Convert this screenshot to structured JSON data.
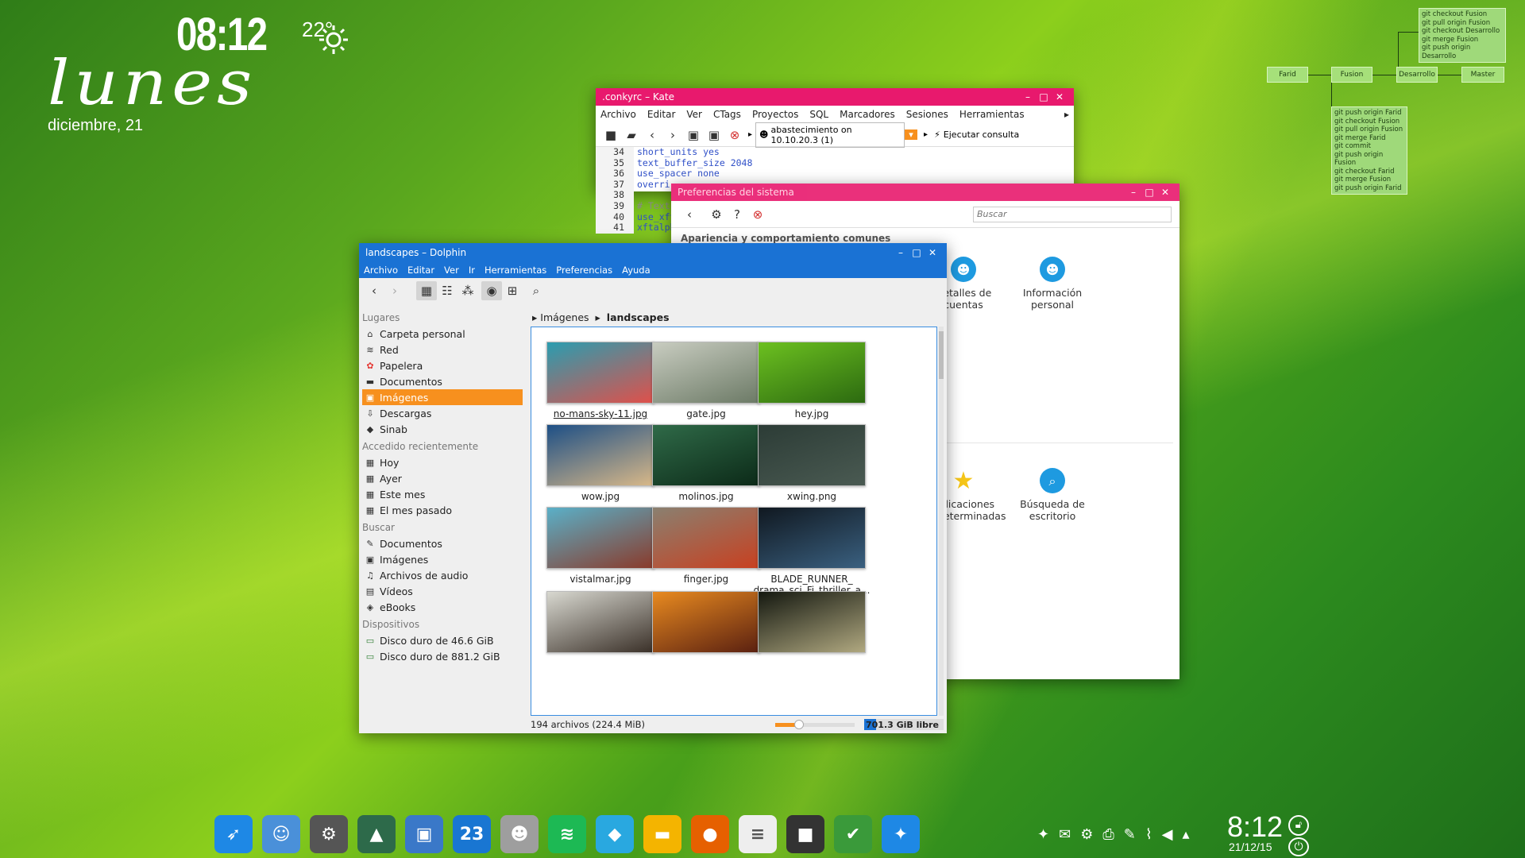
{
  "conky": {
    "time": "08:12",
    "temperature": "22°",
    "weather_icon": "sun-icon",
    "day": "lunes",
    "date": "diciembre, 21"
  },
  "git_graph": {
    "top_box": [
      "git checkout Fusion",
      "git pull origin Fusion",
      "git checkout Desarrollo",
      "git merge Fusion",
      "git push origin Desarrollo"
    ],
    "nodes": [
      "Farid",
      "Fusion",
      "Desarrollo",
      "Master"
    ],
    "bottom_box": [
      "git push origin Farid",
      "git checkout Fusion",
      "git pull origin Fusion",
      "git merge Farid",
      "git commit",
      "git push origin Fusion",
      "git checkout Farid",
      "git merge Fusion",
      "git push origin Farid"
    ]
  },
  "kate": {
    "title": ".conkyrc – Kate",
    "menu": [
      "Archivo",
      "Editar",
      "Ver",
      "CTags",
      "Proyectos",
      "SQL",
      "Marcadores",
      "Sesiones",
      "Herramientas"
    ],
    "connection": "abastecimiento on 10.10.20.3 (1)",
    "run_query": "Ejecutar consulta",
    "line_numbers": [
      "34",
      "35",
      "36",
      "37",
      "38",
      "39",
      "40",
      "41"
    ],
    "lines": [
      "short_units yes",
      "text_buffer_size 2048",
      "use_spacer none",
      "overri",
      "",
      "# Text",
      "use_xft",
      "xftalph"
    ]
  },
  "prefs": {
    "title": "Preferencias del sistema",
    "search_placeholder": "Buscar",
    "section": "Apariencia y comportamiento comunes",
    "items": [
      {
        "label": "Detalles de cuentas",
        "icon": "user-icon"
      },
      {
        "label": "Información personal",
        "icon": "user-icon"
      },
      {
        "label": "Aplicaciones predeterminadas",
        "icon": "star-icon"
      },
      {
        "label": "Búsqueda de escritorio",
        "icon": "search-icon"
      }
    ]
  },
  "dolphin": {
    "title": "landscapes – Dolphin",
    "menu": [
      "Archivo",
      "Editar",
      "Ver",
      "Ir",
      "Herramientas",
      "Preferencias",
      "Ayuda"
    ],
    "sections": [
      {
        "header": "Lugares",
        "items": [
          {
            "label": "Carpeta personal",
            "icon": "home-icon"
          },
          {
            "label": "Red",
            "icon": "wifi-icon"
          },
          {
            "label": "Papelera",
            "icon": "trash-icon"
          },
          {
            "label": "Documentos",
            "icon": "folder-icon"
          },
          {
            "label": "Imágenes",
            "icon": "image-icon"
          },
          {
            "label": "Descargas",
            "icon": "download-icon"
          },
          {
            "label": "Sinab",
            "icon": "diamond-icon"
          }
        ]
      },
      {
        "header": "Accedido recientemente",
        "items": [
          {
            "label": "Hoy",
            "icon": "calendar-icon"
          },
          {
            "label": "Ayer",
            "icon": "calendar-icon"
          },
          {
            "label": "Este mes",
            "icon": "calendar-icon"
          },
          {
            "label": "El mes pasado",
            "icon": "calendar-icon"
          }
        ]
      },
      {
        "header": "Buscar",
        "items": [
          {
            "label": "Documentos",
            "icon": "document-icon"
          },
          {
            "label": "Imágenes",
            "icon": "image-icon"
          },
          {
            "label": "Archivos de audio",
            "icon": "music-icon"
          },
          {
            "label": "Vídeos",
            "icon": "video-icon"
          },
          {
            "label": "eBooks",
            "icon": "book-icon"
          }
        ]
      },
      {
        "header": "Dispositivos",
        "items": [
          {
            "label": "Disco duro de 46.6 GiB",
            "icon": "harddisk-icon"
          },
          {
            "label": "Disco duro de 881.2 GiB",
            "icon": "harddisk-icon"
          }
        ]
      }
    ],
    "breadcrumb": [
      "Imágenes",
      "landscapes"
    ],
    "files": [
      {
        "name": "no-mans-sky-11.jpg",
        "colors": [
          "#2a9db0",
          "#e0504a"
        ]
      },
      {
        "name": "gate.jpg",
        "colors": [
          "#c8ccc0",
          "#6c7a66"
        ]
      },
      {
        "name": "hey.jpg",
        "colors": [
          "#6cc020",
          "#2c6a10"
        ]
      },
      {
        "name": "wow.jpg",
        "colors": [
          "#1d4f86",
          "#d8b888"
        ]
      },
      {
        "name": "molinos.jpg",
        "colors": [
          "#2f6a48",
          "#0c2a18"
        ]
      },
      {
        "name": "xwing.png",
        "colors": [
          "#2c3c36",
          "#4a5a52"
        ]
      },
      {
        "name": "vistalmar.jpg",
        "colors": [
          "#5ab0c8",
          "#8a3a2a"
        ]
      },
      {
        "name": "finger.jpg",
        "colors": [
          "#8a8070",
          "#c84020"
        ]
      },
      {
        "name": "BLADE_RUNNER_ drama_sci_Fi_thriller_a...",
        "colors": [
          "#101820",
          "#3a6080"
        ]
      },
      {
        "name": "",
        "colors": [
          "#d8d8d0",
          "#3a3028"
        ]
      },
      {
        "name": "",
        "colors": [
          "#e88a20",
          "#5a2010"
        ]
      },
      {
        "name": "",
        "colors": [
          "#141810",
          "#b0a880"
        ]
      }
    ],
    "status_count": "194 archivos (224.4 MiB)",
    "free_space": "701.3 GiB libre",
    "zoom_fraction": 0.3,
    "used_fraction": 0.15
  },
  "taskbar": {
    "apps": [
      {
        "name": "launcher-icon",
        "color": "#1e88e5",
        "glyph": "➶"
      },
      {
        "name": "finder-icon",
        "color": "#4a90d9",
        "glyph": "☺"
      },
      {
        "name": "settings-icon",
        "color": "#555555",
        "glyph": "⚙"
      },
      {
        "name": "image-viewer-icon",
        "color": "#2d6a4a",
        "glyph": "▲"
      },
      {
        "name": "photos-icon",
        "color": "#3a78c8",
        "glyph": "▣"
      },
      {
        "name": "calendar-icon",
        "color": "#1976d2",
        "glyph": "23"
      },
      {
        "name": "contacts-icon",
        "color": "#9e9e9e",
        "glyph": "☻"
      },
      {
        "name": "spotify-icon",
        "color": "#1db954",
        "glyph": "≋"
      },
      {
        "name": "package-icon",
        "color": "#29a8e0",
        "glyph": "◆"
      },
      {
        "name": "files-icon",
        "color": "#f4b400",
        "glyph": "▬"
      },
      {
        "name": "firefox-icon",
        "color": "#e66000",
        "glyph": "●"
      },
      {
        "name": "notes-icon",
        "color": "#eeeeee",
        "glyph": "≡"
      },
      {
        "name": "terminal-icon",
        "color": "#333333",
        "glyph": "■"
      },
      {
        "name": "keepass-icon",
        "color": "#3a9a3a",
        "glyph": "✔"
      },
      {
        "name": "messenger-icon",
        "color": "#1e88e5",
        "glyph": "✦"
      }
    ],
    "tray": [
      "messenger-icon",
      "chat-icon",
      "network-icon",
      "printer-icon",
      "notes-icon",
      "clip-icon",
      "volume-icon",
      "arrow-up-icon"
    ],
    "clock": "8:12",
    "date": "21/12/15"
  }
}
